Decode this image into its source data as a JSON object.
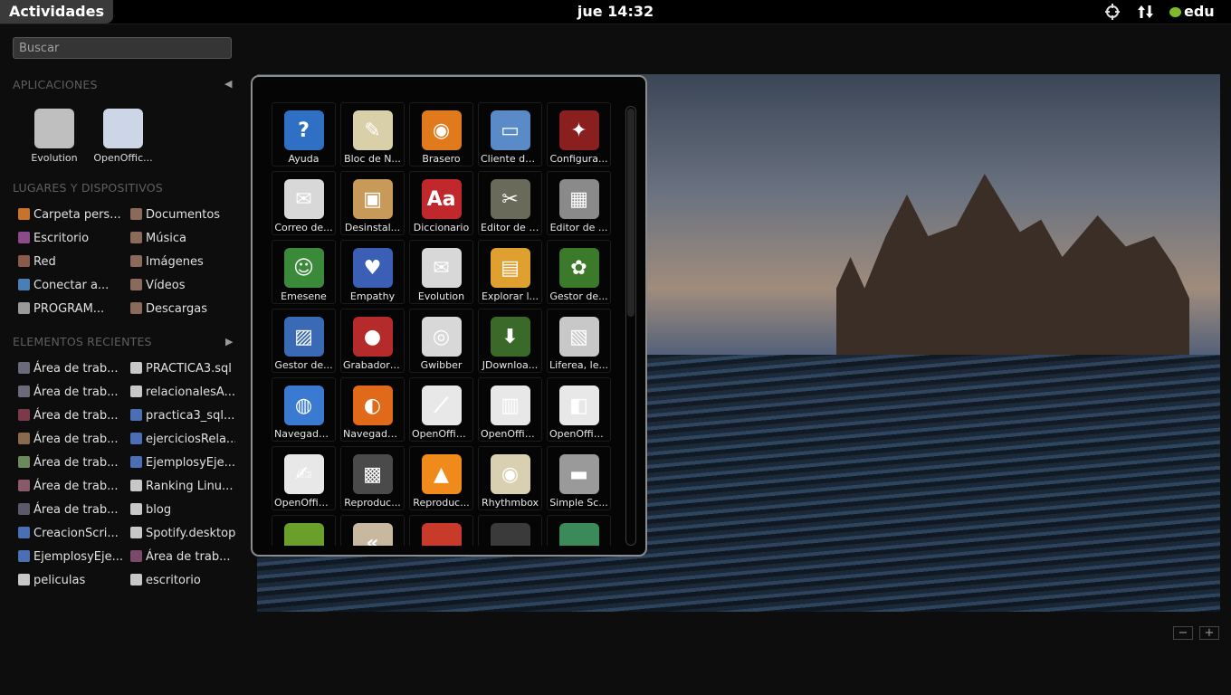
{
  "panel": {
    "activities": "Actividades",
    "clock": "jue 14:32",
    "user": "edu"
  },
  "search": {
    "placeholder": "Buscar"
  },
  "sections": {
    "applications": "APLICACIONES",
    "places": "LUGARES Y DISPOSITIVOS",
    "recent": "ELEMENTOS RECIENTES"
  },
  "favorites": [
    {
      "label": "Evolution",
      "icon": "mail-icon",
      "color": "#bfbfbf"
    },
    {
      "label": "OpenOffic...",
      "icon": "writer-icon",
      "color": "#cdd6e6"
    }
  ],
  "places": [
    {
      "label": "Carpeta pers...",
      "icon": "home-folder-icon",
      "color": "#c8732c"
    },
    {
      "label": "Documentos",
      "icon": "folder-icon",
      "color": "#8a6a5a"
    },
    {
      "label": "Escritorio",
      "icon": "desktop-folder-icon",
      "color": "#8b4a8a"
    },
    {
      "label": "Música",
      "icon": "folder-icon",
      "color": "#8a6a5a"
    },
    {
      "label": "Red",
      "icon": "network-icon",
      "color": "#8a5a4a"
    },
    {
      "label": "Imágenes",
      "icon": "folder-icon",
      "color": "#8a6a5a"
    },
    {
      "label": "Conectar a...",
      "icon": "globe-icon",
      "color": "#4a7fb5"
    },
    {
      "label": "Vídeos",
      "icon": "folder-icon",
      "color": "#8a6a5a"
    },
    {
      "label": "PROGRAM...",
      "icon": "drive-icon",
      "color": "#9a9a9a"
    },
    {
      "label": "Descargas",
      "icon": "folder-icon",
      "color": "#8a6a5a"
    }
  ],
  "recent": [
    {
      "label": "Área de trab...",
      "icon": "screenshot-icon",
      "color": "#6a6a7a"
    },
    {
      "label": "PRACTICA3.sql",
      "icon": "document-icon",
      "color": "#c8c8c8"
    },
    {
      "label": "Área de trab...",
      "icon": "screenshot-icon",
      "color": "#6a6a7a"
    },
    {
      "label": "relacionalesA...",
      "icon": "document-icon",
      "color": "#c8c8c8"
    },
    {
      "label": "Área de trab...",
      "icon": "screenshot-icon",
      "color": "#7a3a4a"
    },
    {
      "label": "practica3_sql...",
      "icon": "word-doc-icon",
      "color": "#4a6fb5"
    },
    {
      "label": "Área de trab...",
      "icon": "screenshot-icon",
      "color": "#8a6a4a"
    },
    {
      "label": "ejerciciosRela...",
      "icon": "word-doc-icon",
      "color": "#4a6fb5"
    },
    {
      "label": "Área de trab...",
      "icon": "screenshot-icon",
      "color": "#6a8a5a"
    },
    {
      "label": "EjemplosyEje...",
      "icon": "word-doc-icon",
      "color": "#4a6fb5"
    },
    {
      "label": "Área de trab...",
      "icon": "screenshot-icon",
      "color": "#8a5a6a"
    },
    {
      "label": "Ranking Linu...",
      "icon": "document-icon",
      "color": "#c8c8c8"
    },
    {
      "label": "Área de trab...",
      "icon": "screenshot-icon",
      "color": "#5a5a6a"
    },
    {
      "label": "blog",
      "icon": "document-icon",
      "color": "#c8c8c8"
    },
    {
      "label": "CreacionScri...",
      "icon": "word-doc-icon",
      "color": "#4a6fb5"
    },
    {
      "label": "Spotify.desktop",
      "icon": "document-icon",
      "color": "#c8c8c8"
    },
    {
      "label": "EjemplosyEje...",
      "icon": "word-doc-icon",
      "color": "#4a6fb5"
    },
    {
      "label": "Área de trab...",
      "icon": "screenshot-icon",
      "color": "#7a4a6a"
    },
    {
      "label": "peliculas",
      "icon": "document-icon",
      "color": "#c8c8c8"
    },
    {
      "label": "escritorio",
      "icon": "document-icon",
      "color": "#c8c8c8"
    }
  ],
  "apps": [
    {
      "label": "Ayuda",
      "icon": "help-icon",
      "glyph": "?",
      "color": "#2f6fc4"
    },
    {
      "label": "Bloc de N...",
      "icon": "notepad-icon",
      "glyph": "✎",
      "color": "#d9cfa8"
    },
    {
      "label": "Brasero",
      "icon": "brasero-icon",
      "glyph": "◉",
      "color": "#e07a1c"
    },
    {
      "label": "Cliente de...",
      "icon": "remote-desktop-icon",
      "glyph": "▭",
      "color": "#5a8ac8"
    },
    {
      "label": "Configura...",
      "icon": "wine-config-icon",
      "glyph": "✦",
      "color": "#8a1f1f"
    },
    {
      "label": "Correo de...",
      "icon": "mail-icon",
      "glyph": "✉",
      "color": "#d8d8d8"
    },
    {
      "label": "Desinstal...",
      "icon": "uninstall-icon",
      "glyph": "▣",
      "color": "#c89a5a"
    },
    {
      "label": "Diccionario",
      "icon": "dictionary-icon",
      "glyph": "Aa",
      "color": "#c0282c"
    },
    {
      "label": "Editor de i...",
      "icon": "gimp-icon",
      "glyph": "✂",
      "color": "#6a6a5a"
    },
    {
      "label": "Editor de ...",
      "icon": "video-editor-icon",
      "glyph": "▦",
      "color": "#8a8a8a"
    },
    {
      "label": "Emesene",
      "icon": "emesene-icon",
      "glyph": "☺",
      "color": "#3a8a3a"
    },
    {
      "label": "Empathy",
      "icon": "empathy-icon",
      "glyph": "♥",
      "color": "#3a5fb5"
    },
    {
      "label": "Evolution",
      "icon": "mail-icon",
      "glyph": "✉",
      "color": "#d8d8d8"
    },
    {
      "label": "Explorar l...",
      "icon": "file-browser-icon",
      "glyph": "▤",
      "color": "#e0a030"
    },
    {
      "label": "Gestor de...",
      "icon": "fern-icon",
      "glyph": "✿",
      "color": "#3a7a2a"
    },
    {
      "label": "Gestor de...",
      "icon": "image-viewer-icon",
      "glyph": "▨",
      "color": "#3a6ab5"
    },
    {
      "label": "Grabador ...",
      "icon": "microphone-icon",
      "glyph": "●",
      "color": "#b52a2a"
    },
    {
      "label": "Gwibber",
      "icon": "gwibber-icon",
      "glyph": "◎",
      "color": "#d8d8d8"
    },
    {
      "label": "JDownloa...",
      "icon": "jdownloader-icon",
      "glyph": "⬇",
      "color": "#3a6a2a"
    },
    {
      "label": "Liferea, le...",
      "icon": "news-icon",
      "glyph": "▧",
      "color": "#c8c8c8"
    },
    {
      "label": "Navegado...",
      "icon": "chromium-icon",
      "glyph": "◍",
      "color": "#3a7ad0"
    },
    {
      "label": "Navegado...",
      "icon": "firefox-icon",
      "glyph": "◐",
      "color": "#e06a1a"
    },
    {
      "label": "OpenOffic...",
      "icon": "draw-icon",
      "glyph": "⟋",
      "color": "#e8e8e8"
    },
    {
      "label": "OpenOffic...",
      "icon": "calc-icon",
      "glyph": "▥",
      "color": "#e8e8e8"
    },
    {
      "label": "OpenOffic...",
      "icon": "impress-icon",
      "glyph": "◧",
      "color": "#e8e8e8"
    },
    {
      "label": "OpenOffic...",
      "icon": "writer-icon",
      "glyph": "✍",
      "color": "#e8e8e8"
    },
    {
      "label": "Reproduc...",
      "icon": "clapper-icon",
      "glyph": "▩",
      "color": "#4a4a4a"
    },
    {
      "label": "Reproduc...",
      "icon": "vlc-icon",
      "glyph": "▲",
      "color": "#f08a1a"
    },
    {
      "label": "Rhythmbox",
      "icon": "rhythmbox-icon",
      "glyph": "◉",
      "color": "#d8d0b0"
    },
    {
      "label": "Simple Sc...",
      "icon": "scanner-icon",
      "glyph": "▬",
      "color": "#9a9a9a"
    },
    {
      "label": "",
      "icon": "spotify-icon",
      "glyph": "",
      "color": "#6aa02a"
    },
    {
      "label": "",
      "icon": "back-arrow-icon",
      "glyph": "«",
      "color": "#c8b8a0"
    },
    {
      "label": "",
      "icon": "joystick-icon",
      "glyph": "",
      "color": "#c83a2a"
    },
    {
      "label": "",
      "icon": "pen-icon",
      "glyph": "",
      "color": "#3a3a3a"
    },
    {
      "label": "",
      "icon": "globe-icon",
      "glyph": "",
      "color": "#3a8a5a"
    }
  ],
  "zoom": {
    "out": "−",
    "in": "+"
  }
}
